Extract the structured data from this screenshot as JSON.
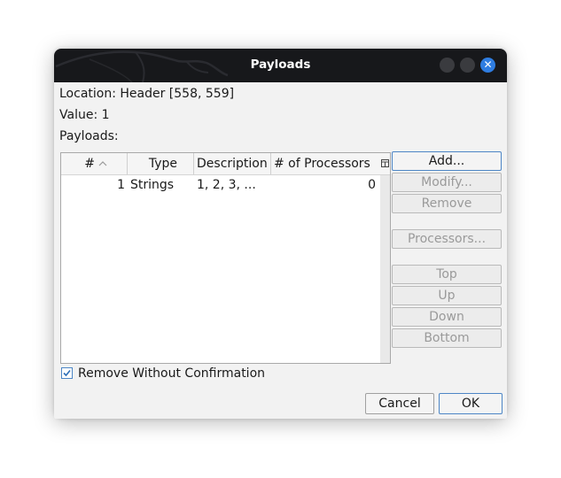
{
  "window": {
    "title": "Payloads",
    "close_glyph": "✕"
  },
  "info": {
    "location": "Location: Header [558, 559]",
    "value": "Value: 1",
    "payloads_label": "Payloads:"
  },
  "table": {
    "columns": [
      "#",
      "Type",
      "Description",
      "# of Processors"
    ],
    "sort_indicator": "^",
    "rows": [
      {
        "num": "1",
        "type": "Strings",
        "description": "1, 2, 3, ...",
        "processors": "0"
      }
    ]
  },
  "buttons": {
    "add": "Add...",
    "modify": "Modify...",
    "remove": "Remove",
    "processors": "Processors...",
    "top": "Top",
    "up": "Up",
    "down": "Down",
    "bottom": "Bottom",
    "cancel": "Cancel",
    "ok": "OK"
  },
  "options": {
    "remove_without_confirmation": "Remove Without Confirmation",
    "remove_without_confirmation_checked": true
  },
  "colors": {
    "titlebar": "#17181b",
    "close_button": "#2f7de1",
    "focus_border": "#4d86c6"
  }
}
